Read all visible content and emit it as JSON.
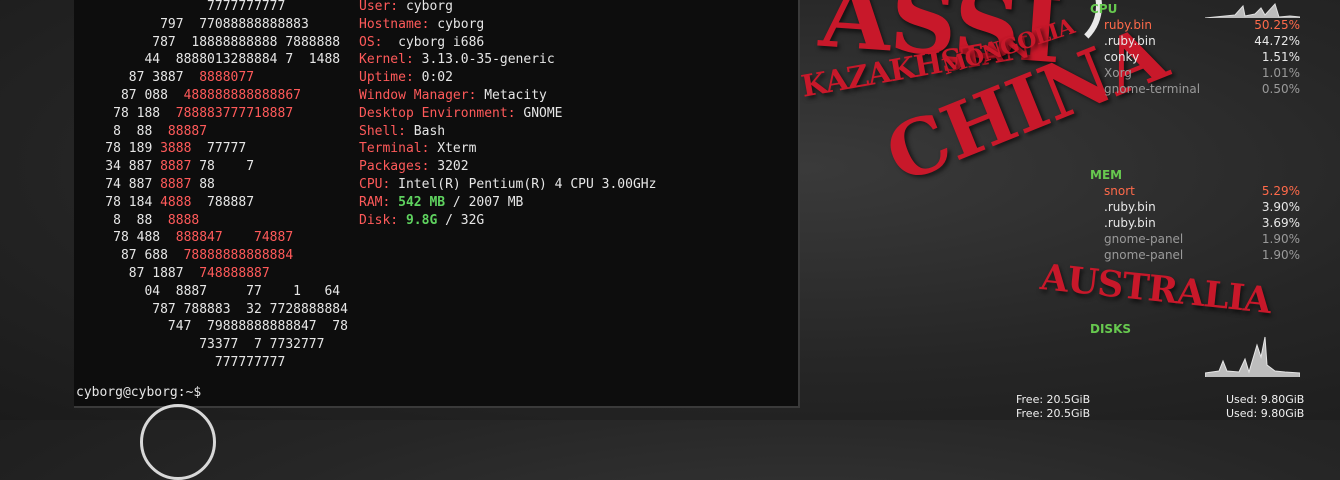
{
  "terminal": {
    "logo_lines": [
      [
        [
          "                 7777777777",
          ""
        ]
      ],
      [
        [
          "           797  77088888888883",
          ""
        ]
      ],
      [
        [
          "          787  18888888888 7888888",
          ""
        ]
      ],
      [
        [
          "         44  8888013288884 7  1488",
          ""
        ]
      ],
      [
        [
          "       87 3887  ",
          ""
        ],
        [
          "8888077",
          "r"
        ]
      ],
      [
        [
          "      87 088  ",
          ""
        ],
        [
          "488888888888867",
          "r"
        ]
      ],
      [
        [
          "     78 188  ",
          ""
        ],
        [
          "788883777718887",
          "r"
        ]
      ],
      [
        [
          "     8  88  ",
          ""
        ],
        [
          "88887",
          "r"
        ]
      ],
      [
        [
          "    78 189 ",
          ""
        ],
        [
          "3888",
          "r"
        ],
        [
          "  77777",
          ""
        ]
      ],
      [
        [
          "    34 887 ",
          ""
        ],
        [
          "8887",
          "r"
        ],
        [
          " 78    7",
          ""
        ]
      ],
      [
        [
          "    74 887 ",
          ""
        ],
        [
          "8887",
          "r"
        ],
        [
          " 88",
          ""
        ]
      ],
      [
        [
          "    78 184 ",
          ""
        ],
        [
          "4888",
          "r"
        ],
        [
          "  788887",
          ""
        ]
      ],
      [
        [
          "     8  88  ",
          ""
        ],
        [
          "8888",
          "r"
        ]
      ],
      [
        [
          "     78 488  ",
          ""
        ],
        [
          "888847    74887",
          "r"
        ]
      ],
      [
        [
          "      87 688  ",
          ""
        ],
        [
          "78888888888884",
          "r"
        ]
      ],
      [
        [
          "       87 1887  ",
          ""
        ],
        [
          "748888887",
          "r"
        ]
      ],
      [
        [
          "         04  8887     77    1   64",
          ""
        ]
      ],
      [
        [
          "          787 788883  32 7728888884",
          ""
        ]
      ],
      [
        [
          "            747  79888888888847  78",
          ""
        ]
      ],
      [
        [
          "                73377  7 7732777",
          ""
        ]
      ],
      [
        [
          "                  777777777",
          ""
        ]
      ]
    ],
    "info": [
      {
        "key": "User:",
        "value": " cyborg"
      },
      {
        "key": "Hostname:",
        "value": " cyborg"
      },
      {
        "key": "OS:",
        "value": "  cyborg i686"
      },
      {
        "key": "Kernel:",
        "value": " 3.13.0-35-generic"
      },
      {
        "key": "Uptime:",
        "value": " 0:02"
      },
      {
        "key": "Window Manager:",
        "value": " Metacity"
      },
      {
        "key": "Desktop Environment:",
        "value": " GNOME"
      },
      {
        "key": "Shell:",
        "value": " Bash"
      },
      {
        "key": "Terminal:",
        "value": " Xterm"
      },
      {
        "key": "Packages:",
        "value": " 3202"
      },
      {
        "key": "CPU:",
        "value": " Intel(R) Pentium(R) 4 CPU 3.00GHz"
      }
    ],
    "ram": {
      "key": "RAM:",
      "used": "542 MB",
      "sep": " / ",
      "total": "2007 MB"
    },
    "disk": {
      "key": "Disk:",
      "used": "9.8G",
      "sep": " / ",
      "total": "32G"
    },
    "prompt": "cyborg@cyborg:~$"
  },
  "conky": {
    "cpu": {
      "title": "CPU",
      "processes": [
        {
          "name": "ruby.bin",
          "value": "50.25%",
          "style": "hot"
        },
        {
          "name": ".ruby.bin",
          "value": "44.72%",
          "style": ""
        },
        {
          "name": "conky",
          "value": "1.51%",
          "style": ""
        },
        {
          "name": "Xorg",
          "value": "1.01%",
          "style": "dim"
        },
        {
          "name": "gnome-terminal",
          "value": "0.50%",
          "style": "dim"
        }
      ]
    },
    "mem": {
      "title": "MEM",
      "processes": [
        {
          "name": "snort",
          "value": "5.29%",
          "style": "hot"
        },
        {
          "name": ".ruby.bin",
          "value": "3.90%",
          "style": ""
        },
        {
          "name": ".ruby.bin",
          "value": "3.69%",
          "style": ""
        },
        {
          "name": "gnome-panel",
          "value": "1.90%",
          "style": "dim"
        },
        {
          "name": "gnome-panel",
          "value": "1.90%",
          "style": "dim"
        }
      ]
    },
    "disks": {
      "title": "DISKS",
      "rows": [
        {
          "free": "Free: 20.5GiB",
          "used": "Used: 9.80GiB"
        },
        {
          "free": "Free: 20.5GiB",
          "used": "Used: 9.80GiB"
        }
      ]
    }
  },
  "wallpaper": {
    "words": [
      "ASSI",
      "KAZAKHSTAN",
      "MONGOLIA",
      "CHINA",
      "AUSTRALIA"
    ]
  },
  "colors": {
    "terminal_bg": "#0d0d0d",
    "key_red": "#ff5a5a",
    "value_green": "#5fd35f",
    "conky_header_green": "#67c94f",
    "conky_hot": "#ff6a4a",
    "map_red": "#c8182a"
  }
}
